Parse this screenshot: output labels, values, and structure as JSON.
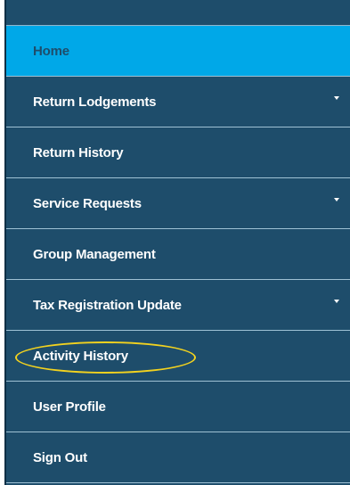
{
  "menu": {
    "items": [
      {
        "label": "Home",
        "active": true,
        "has_submenu": false
      },
      {
        "label": "Return Lodgements",
        "active": false,
        "has_submenu": true
      },
      {
        "label": "Return History",
        "active": false,
        "has_submenu": false
      },
      {
        "label": "Service Requests",
        "active": false,
        "has_submenu": true
      },
      {
        "label": "Group Management",
        "active": false,
        "has_submenu": false
      },
      {
        "label": "Tax Registration Update",
        "active": false,
        "has_submenu": true
      },
      {
        "label": "Activity History",
        "active": false,
        "has_submenu": false,
        "highlighted": true
      },
      {
        "label": "User Profile",
        "active": false,
        "has_submenu": false
      },
      {
        "label": "Sign Out",
        "active": false,
        "has_submenu": false
      }
    ],
    "colors": {
      "background": "#1e4d6b",
      "active_background": "#00a8e8",
      "active_text": "#1e4d6b",
      "text": "#ffffff",
      "divider": "#9fc1d4",
      "highlight_ring": "#f2d21f"
    },
    "submenu_indicator_icon": "caret-down-icon"
  }
}
